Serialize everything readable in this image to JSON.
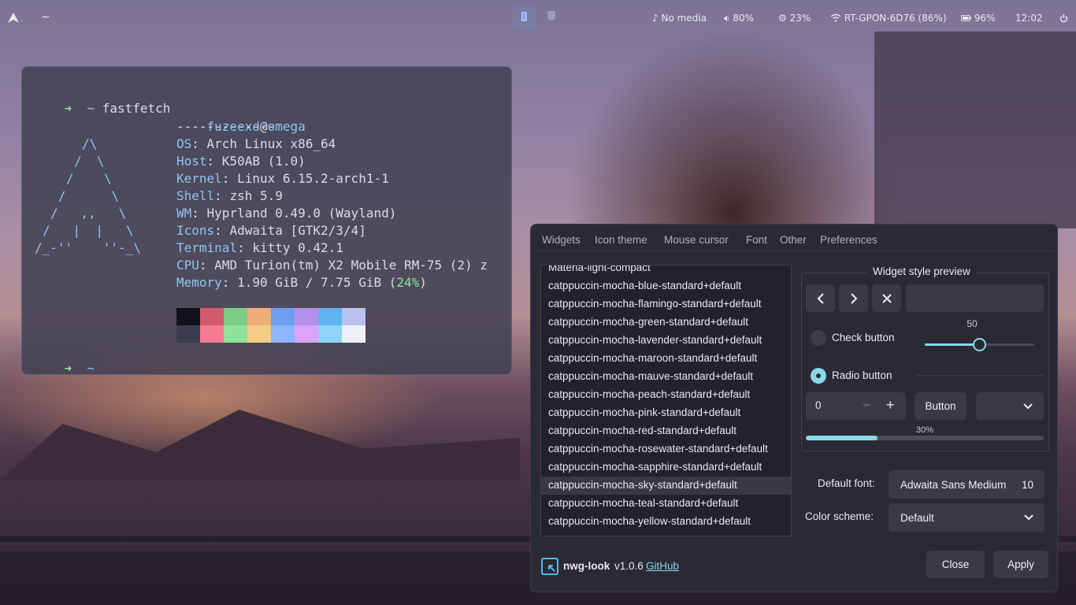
{
  "topbar": {
    "workspace_label": "~",
    "media": "No media",
    "volume": "80%",
    "cpu": "23%",
    "network": "RT-GPON-6D76 (86%)",
    "battery": "96%",
    "clock": "12:02"
  },
  "terminal": {
    "prompt_symbol": "➜",
    "prompt_dir": "~",
    "command": "fastfetch",
    "logo_lines": [
      "/\\",
      "/  \\",
      "/    \\",
      "/      \\",
      "/   ,,   \\",
      "/   |  |   \\",
      "/_-''    ''-_\\"
    ],
    "user": "fuzeexd",
    "at": "@",
    "host": "omega",
    "separator": "-------------",
    "info": [
      {
        "key": "OS",
        "value": "Arch Linux x86_64"
      },
      {
        "key": "Host",
        "value": "K50AB (1.0)"
      },
      {
        "key": "Kernel",
        "value": "Linux 6.15.2-arch1-1"
      },
      {
        "key": "Shell",
        "value": "zsh 5.9"
      },
      {
        "key": "WM",
        "value": "Hyprland 0.49.0 (Wayland)"
      },
      {
        "key": "Icons",
        "value": "Adwaita [GTK2/3/4]"
      },
      {
        "key": "Terminal",
        "value": "kitty 0.42.1"
      },
      {
        "key": "CPU",
        "value": "AMD Turion(tm) X2 Mobile RM-75 (2) z"
      }
    ],
    "memory_key": "Memory",
    "memory_value": "1.90 GiB / 7.75 GiB (",
    "memory_percent": "24%",
    "memory_close": ")",
    "palette_top": [
      "#11111b",
      "#d25a6c",
      "#7dcc86",
      "#efad7e",
      "#6e9ef2",
      "#b590ea",
      "#5fb4ee",
      "#bac2f2"
    ],
    "palette_bottom": [
      "#3a3b4c",
      "#f37c92",
      "#8fe29c",
      "#f6cd86",
      "#8eb4fb",
      "#d9a4f8",
      "#8ed4fb",
      "#eef0f7"
    ]
  },
  "nwg": {
    "tabs": [
      "Widgets",
      "Icon theme",
      "Mouse cursor",
      "Font",
      "Other",
      "Preferences"
    ],
    "themes": [
      "Materia-light-compact",
      "catppuccin-mocha-blue-standard+default",
      "catppuccin-mocha-flamingo-standard+default",
      "catppuccin-mocha-green-standard+default",
      "catppuccin-mocha-lavender-standard+default",
      "catppuccin-mocha-maroon-standard+default",
      "catppuccin-mocha-mauve-standard+default",
      "catppuccin-mocha-peach-standard+default",
      "catppuccin-mocha-pink-standard+default",
      "catppuccin-mocha-red-standard+default",
      "catppuccin-mocha-rosewater-standard+default",
      "catppuccin-mocha-sapphire-standard+default",
      "catppuccin-mocha-sky-standard+default",
      "catppuccin-mocha-teal-standard+default",
      "catppuccin-mocha-yellow-standard+default"
    ],
    "selected_theme_index": 12,
    "preview_title": "Widget style preview",
    "slider_value": "50",
    "slider_fraction": 0.5,
    "check_label": "Check button",
    "radio_label": "Radio button",
    "spin_value": "0",
    "button_label": "Button",
    "progress_label": "30%",
    "progress_fraction": 0.3,
    "default_font_label": "Default font:",
    "default_font_value": "Adwaita Sans Medium",
    "default_font_size": "10",
    "color_scheme_label": "Color scheme:",
    "color_scheme_value": "Default",
    "app_name": "nwg-look",
    "version": "v1.0.6",
    "github": "GitHub",
    "close_label": "Close",
    "apply_label": "Apply",
    "accent": "#8ad8e8"
  }
}
